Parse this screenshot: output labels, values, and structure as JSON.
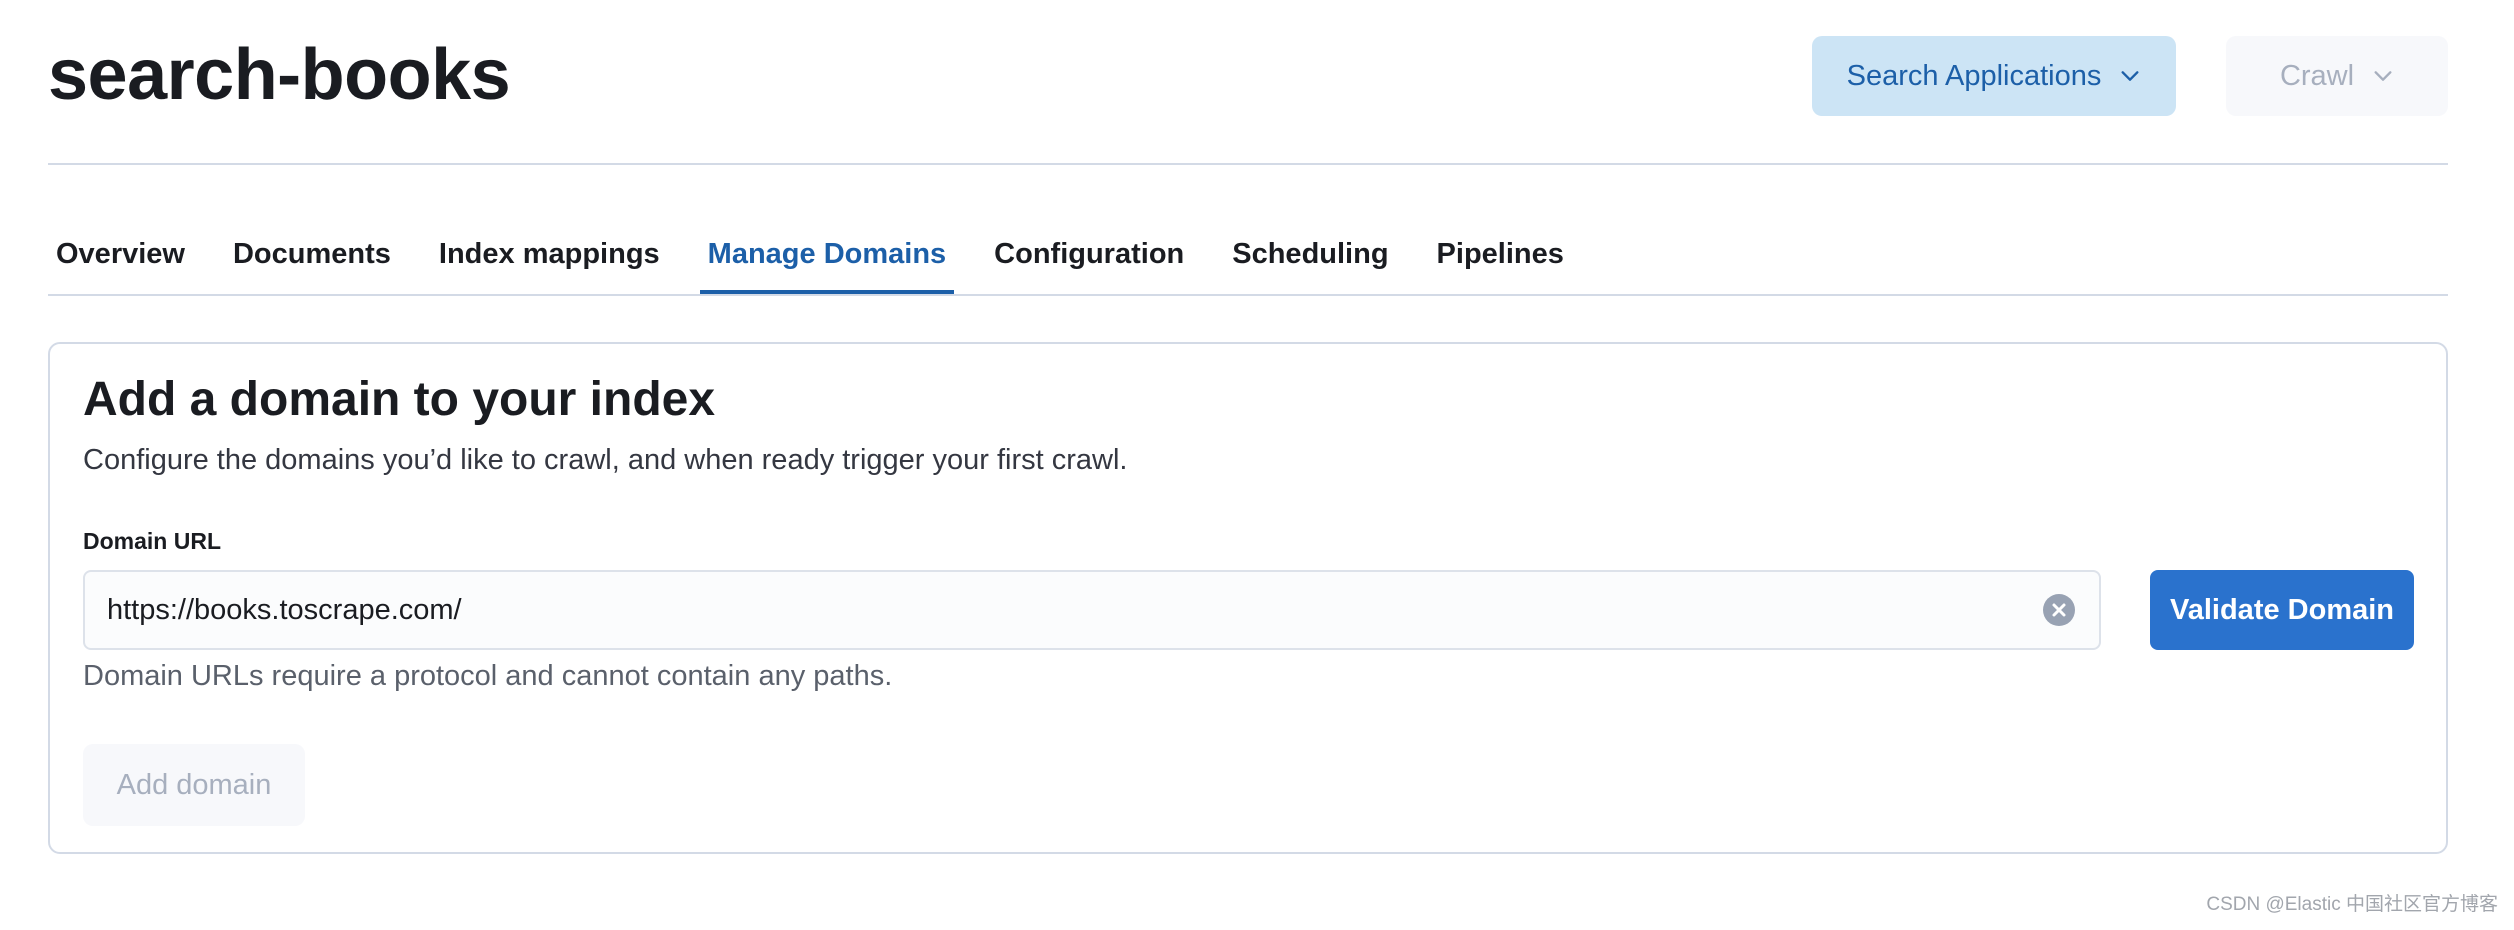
{
  "header": {
    "title": "search-books",
    "search_applications_label": "Search Applications",
    "crawl_label": "Crawl"
  },
  "tabs": [
    {
      "label": "Overview",
      "active": false
    },
    {
      "label": "Documents",
      "active": false
    },
    {
      "label": "Index mappings",
      "active": false
    },
    {
      "label": "Manage Domains",
      "active": true
    },
    {
      "label": "Configuration",
      "active": false
    },
    {
      "label": "Scheduling",
      "active": false
    },
    {
      "label": "Pipelines",
      "active": false
    }
  ],
  "panel": {
    "title": "Add a domain to your index",
    "description": "Configure the domains you’d like to crawl, and when ready trigger your first crawl.",
    "field_label": "Domain URL",
    "domain_value": "https://books.toscrape.com/",
    "validate_label": "Validate Domain",
    "help_text": "Domain URLs require a protocol and cannot contain any paths.",
    "add_domain_label": "Add domain"
  },
  "watermark": "CSDN @Elastic 中国社区官方博客",
  "colors": {
    "accent": "#1c5fa8",
    "primary_button": "#2a72cd",
    "secondary_button_bg": "#cce4f5",
    "disabled_bg": "#f7f8fb",
    "disabled_text": "#a7afbe",
    "border": "#d3dae6"
  },
  "icons": {
    "dropdown": "chevron-down-icon",
    "clear": "clear-circle-icon"
  }
}
